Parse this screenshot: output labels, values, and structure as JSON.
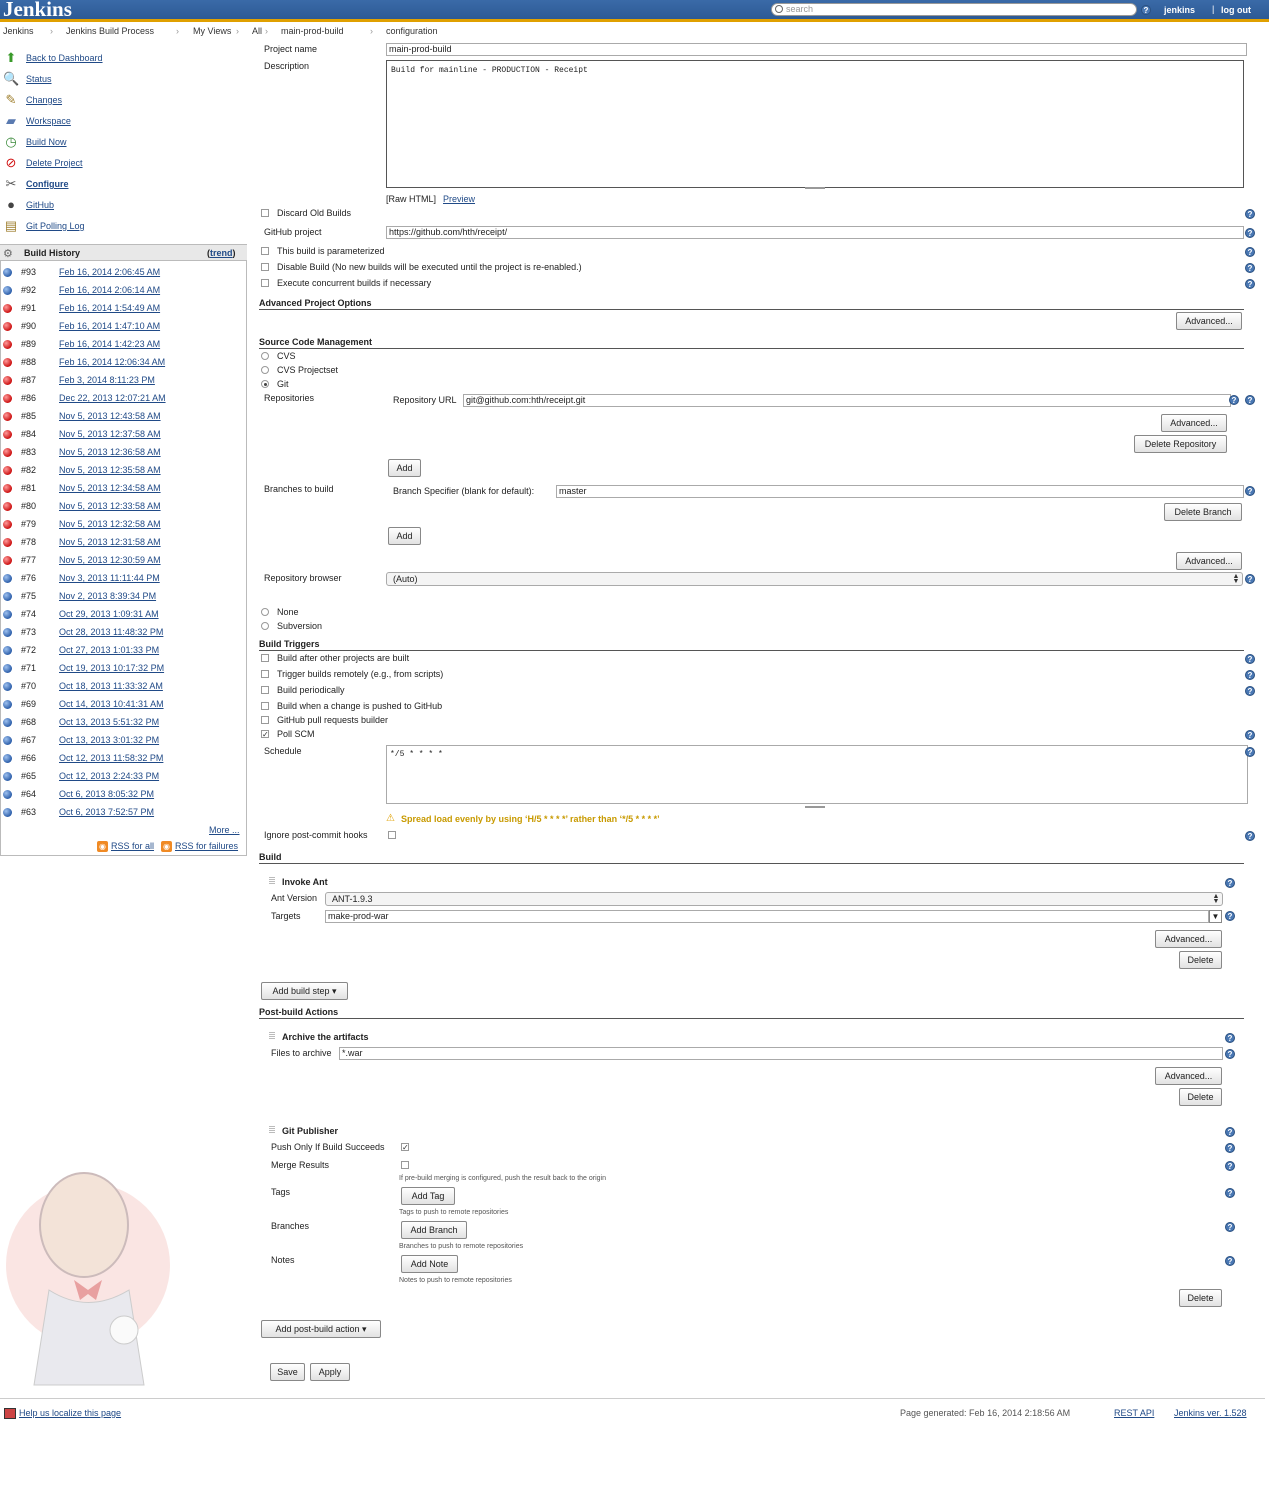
{
  "header": {
    "logo": "Jenkins",
    "search_placeholder": "search",
    "user": "jenkins",
    "logout": "log out"
  },
  "breadcrumbs": [
    "Jenkins",
    "Jenkins Build Process",
    "My Views",
    "All",
    "main-prod-build",
    "configuration"
  ],
  "sidebar": {
    "items": [
      {
        "label": "Back to Dashboard",
        "icon": "up-arrow-icon"
      },
      {
        "label": "Status",
        "icon": "magnifier-icon"
      },
      {
        "label": "Changes",
        "icon": "notepad-icon"
      },
      {
        "label": "Workspace",
        "icon": "folder-icon"
      },
      {
        "label": "Build Now",
        "icon": "clock-icon"
      },
      {
        "label": "Delete Project",
        "icon": "no-entry-icon"
      },
      {
        "label": "Configure",
        "icon": "wrench-icon"
      },
      {
        "label": "GitHub",
        "icon": "github-icon"
      },
      {
        "label": "Git Polling Log",
        "icon": "clipboard-icon"
      }
    ]
  },
  "build_history": {
    "title": "Build History",
    "trend": "trend",
    "more": "More ...",
    "rss_all": "RSS for all",
    "rss_failures": "RSS for failures",
    "builds": [
      {
        "num": "#93",
        "date": "Feb 16, 2014 2:06:45 AM",
        "status": "blue"
      },
      {
        "num": "#92",
        "date": "Feb 16, 2014 2:06:14 AM",
        "status": "blue"
      },
      {
        "num": "#91",
        "date": "Feb 16, 2014 1:54:49 AM",
        "status": "red"
      },
      {
        "num": "#90",
        "date": "Feb 16, 2014 1:47:10 AM",
        "status": "red"
      },
      {
        "num": "#89",
        "date": "Feb 16, 2014 1:42:23 AM",
        "status": "red"
      },
      {
        "num": "#88",
        "date": "Feb 16, 2014 12:06:34 AM",
        "status": "red"
      },
      {
        "num": "#87",
        "date": "Feb 3, 2014 8:11:23 PM",
        "status": "red"
      },
      {
        "num": "#86",
        "date": "Dec 22, 2013 12:07:21 AM",
        "status": "red"
      },
      {
        "num": "#85",
        "date": "Nov 5, 2013 12:43:58 AM",
        "status": "red"
      },
      {
        "num": "#84",
        "date": "Nov 5, 2013 12:37:58 AM",
        "status": "red"
      },
      {
        "num": "#83",
        "date": "Nov 5, 2013 12:36:58 AM",
        "status": "red"
      },
      {
        "num": "#82",
        "date": "Nov 5, 2013 12:35:58 AM",
        "status": "red"
      },
      {
        "num": "#81",
        "date": "Nov 5, 2013 12:34:58 AM",
        "status": "red"
      },
      {
        "num": "#80",
        "date": "Nov 5, 2013 12:33:58 AM",
        "status": "red"
      },
      {
        "num": "#79",
        "date": "Nov 5, 2013 12:32:58 AM",
        "status": "red"
      },
      {
        "num": "#78",
        "date": "Nov 5, 2013 12:31:58 AM",
        "status": "red"
      },
      {
        "num": "#77",
        "date": "Nov 5, 2013 12:30:59 AM",
        "status": "red"
      },
      {
        "num": "#76",
        "date": "Nov 3, 2013 11:11:44 PM",
        "status": "blue"
      },
      {
        "num": "#75",
        "date": "Nov 2, 2013 8:39:34 PM",
        "status": "blue"
      },
      {
        "num": "#74",
        "date": "Oct 29, 2013 1:09:31 AM",
        "status": "blue"
      },
      {
        "num": "#73",
        "date": "Oct 28, 2013 11:48:32 PM",
        "status": "blue"
      },
      {
        "num": "#72",
        "date": "Oct 27, 2013 1:01:33 PM",
        "status": "blue"
      },
      {
        "num": "#71",
        "date": "Oct 19, 2013 10:17:32 PM",
        "status": "blue"
      },
      {
        "num": "#70",
        "date": "Oct 18, 2013 11:33:32 AM",
        "status": "blue"
      },
      {
        "num": "#69",
        "date": "Oct 14, 2013 10:41:31 AM",
        "status": "blue"
      },
      {
        "num": "#68",
        "date": "Oct 13, 2013 5:51:32 PM",
        "status": "blue"
      },
      {
        "num": "#67",
        "date": "Oct 13, 2013 3:01:32 PM",
        "status": "blue"
      },
      {
        "num": "#66",
        "date": "Oct 12, 2013 11:58:32 PM",
        "status": "blue"
      },
      {
        "num": "#65",
        "date": "Oct 12, 2013 2:24:33 PM",
        "status": "blue"
      },
      {
        "num": "#64",
        "date": "Oct 6, 2013 8:05:32 PM",
        "status": "blue"
      },
      {
        "num": "#63",
        "date": "Oct 6, 2013 7:52:57 PM",
        "status": "blue"
      }
    ]
  },
  "form": {
    "project_name_label": "Project name",
    "project_name": "main-prod-build",
    "description_label": "Description",
    "description": "Build for mainline - PRODUCTION - Receipt",
    "raw_html": "[Raw HTML]",
    "preview": "Preview",
    "discard_old": "Discard Old Builds",
    "github_project_label": "GitHub project",
    "github_project": "https://github.com/hth/receipt/",
    "parameterized": "This build is parameterized",
    "disable_build": "Disable Build (No new builds will be executed until the project is re-enabled.)",
    "concurrent": "Execute concurrent builds if necessary",
    "advanced_project_options": "Advanced Project Options",
    "advanced": "Advanced...",
    "scm_title": "Source Code Management",
    "scm_cvs": "CVS",
    "scm_cvs_projectset": "CVS Projectset",
    "scm_git": "Git",
    "repositories_label": "Repositories",
    "repo_url_label": "Repository URL",
    "repo_url": "git@github.com:hth/receipt.git",
    "delete_repository": "Delete Repository",
    "add": "Add",
    "branches_label": "Branches to build",
    "branch_spec_label": "Branch Specifier (blank for default):",
    "branch_spec": "master",
    "delete_branch": "Delete Branch",
    "repo_browser_label": "Repository browser",
    "repo_browser": "(Auto)",
    "scm_none": "None",
    "scm_subversion": "Subversion",
    "triggers_title": "Build Triggers",
    "trig_after_other": "Build after other projects are built",
    "trig_remote": "Trigger builds remotely (e.g., from scripts)",
    "trig_periodic": "Build periodically",
    "trig_github_push": "Build when a change is pushed to GitHub",
    "trig_github_pr": "GitHub pull requests builder",
    "trig_poll_scm": "Poll SCM",
    "schedule_label": "Schedule",
    "schedule": "*/5 * * * *",
    "schedule_warning": "Spread load evenly by using ‘H/5 * * * *’ rather than ‘*/5 * * * *’",
    "ignore_hooks": "Ignore post-commit hooks",
    "build_title": "Build",
    "invoke_ant": "Invoke Ant",
    "ant_version_label": "Ant Version",
    "ant_version": "ANT-1.9.3",
    "targets_label": "Targets",
    "targets": "make-prod-war",
    "delete": "Delete",
    "add_build_step": "Add build step",
    "post_build_title": "Post-build Actions",
    "archive_title": "Archive the artifacts",
    "files_to_archive_label": "Files to archive",
    "files_to_archive": "*.war",
    "git_publisher": "Git Publisher",
    "push_only_if_succeeds": "Push Only If Build Succeeds",
    "merge_results": "Merge Results",
    "merge_hint": "If pre-build merging is configured, push the result back to the origin",
    "tags_label": "Tags",
    "add_tag": "Add Tag",
    "tags_hint": "Tags to push to remote repositories",
    "branches_pub_label": "Branches",
    "add_branch": "Add Branch",
    "branches_hint": "Branches to push to remote repositories",
    "notes_label": "Notes",
    "add_note": "Add Note",
    "notes_hint": "Notes to push to remote repositories",
    "add_post_build": "Add post-build action",
    "save": "Save",
    "apply": "Apply"
  },
  "footer": {
    "localize": "Help us localize this page",
    "generated": "Page generated: Feb 16, 2014 2:18:56 AM",
    "rest_api": "REST API",
    "version": "Jenkins ver. 1.528"
  }
}
